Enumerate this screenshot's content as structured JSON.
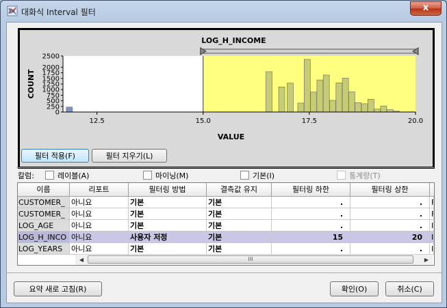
{
  "window": {
    "title": "대화식 Interval 필터",
    "close_label": "x"
  },
  "chart_data": {
    "type": "bar",
    "title": "LOG_H_INCOME",
    "xlabel": "VALUE",
    "ylabel": "COUNT",
    "xlim": [
      11.7,
      20.0
    ],
    "ylim": [
      0,
      2500
    ],
    "xticks": [
      "12.5",
      "15.0",
      "17.5",
      "20.0"
    ],
    "yticks": [
      "0",
      "250",
      "500",
      "750",
      "1000",
      "1250",
      "1500",
      "1750",
      "2000",
      "2500"
    ],
    "selection_range": [
      15.0,
      20.0
    ],
    "bins": [
      {
        "x": 11.85,
        "value": 220
      },
      {
        "x": 16.55,
        "value": 1800
      },
      {
        "x": 16.85,
        "value": 1120
      },
      {
        "x": 17.05,
        "value": 1290
      },
      {
        "x": 17.3,
        "value": 400
      },
      {
        "x": 17.45,
        "value": 2350
      },
      {
        "x": 17.6,
        "value": 890
      },
      {
        "x": 17.75,
        "value": 1430
      },
      {
        "x": 17.9,
        "value": 1650
      },
      {
        "x": 18.05,
        "value": 520
      },
      {
        "x": 18.2,
        "value": 1300
      },
      {
        "x": 18.35,
        "value": 1510
      },
      {
        "x": 18.5,
        "value": 900
      },
      {
        "x": 18.65,
        "value": 420
      },
      {
        "x": 18.8,
        "value": 370
      },
      {
        "x": 18.95,
        "value": 570
      },
      {
        "x": 19.1,
        "value": 130
      },
      {
        "x": 19.25,
        "value": 270
      },
      {
        "x": 19.4,
        "value": 110
      },
      {
        "x": 19.55,
        "value": 40
      }
    ],
    "colors": {
      "selection": "#ffff80",
      "bar": "#c6cc73",
      "bar_left": "#7c94c8"
    }
  },
  "buttons": {
    "apply": "필터 적용(F)",
    "clear": "필터 지우기(L)",
    "refresh": "요약 새로 고침(R)",
    "ok": "확인(O)",
    "cancel": "취소(C)"
  },
  "column_options": {
    "label": "칼럼:",
    "checkboxes": [
      {
        "label": "레이블(A)",
        "checked": false,
        "enabled": true
      },
      {
        "label": "마이닝(M)",
        "checked": false,
        "enabled": true
      },
      {
        "label": "기본(I)",
        "checked": false,
        "enabled": true
      },
      {
        "label": "통계량(T)",
        "checked": false,
        "enabled": false
      }
    ]
  },
  "table": {
    "headers": [
      "이름",
      "리포트",
      "필터링 방법",
      "결측값 유지",
      "필터링 하한",
      "필터링 상한"
    ],
    "rows": [
      {
        "name": "CUSTOMER_",
        "report": "아니요",
        "method": "기본",
        "missing": "기본",
        "lower": ".",
        "upper": ".",
        "extra": "F"
      },
      {
        "name": "CUSTOMER_",
        "report": "아니요",
        "method": "기본",
        "missing": "기본",
        "lower": ".",
        "upper": ".",
        "extra": "F"
      },
      {
        "name": "LOG_AGE",
        "report": "아니요",
        "method": "기본",
        "missing": "기본",
        "lower": ".",
        "upper": ".",
        "extra": "I"
      },
      {
        "name": "LOG_H_INCO",
        "report": "아니요",
        "method": "사용자 저정",
        "missing": "기본",
        "lower": "15",
        "upper": "20",
        "extra": "I",
        "selected": true
      },
      {
        "name": "LOG_YEARS",
        "report": "아니요",
        "method": "기본",
        "missing": "기본",
        "lower": ".",
        "upper": ".",
        "extra": "I"
      }
    ],
    "scroll_thumb_label": "III"
  }
}
